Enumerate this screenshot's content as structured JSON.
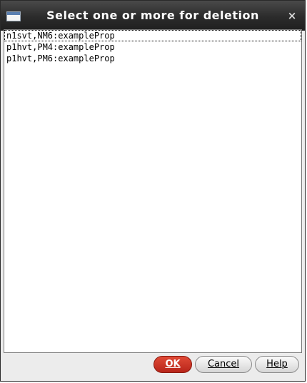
{
  "window": {
    "title": "Select one or more for deletion",
    "close_glyph": "×"
  },
  "list": {
    "items": [
      {
        "label": "n1svt,NM6:exampleProp",
        "focused": true
      },
      {
        "label": "p1hvt,PM4:exampleProp",
        "focused": false
      },
      {
        "label": "p1hvt,PM6:exampleProp",
        "focused": false
      }
    ]
  },
  "buttons": {
    "ok_label": "OK",
    "cancel_label": "Cancel",
    "help_label": "Help"
  },
  "colors": {
    "titlebar": "#2b2b2b",
    "ok_button": "#c7301f",
    "background": "#ececec"
  },
  "icons": {
    "window_icon": "window-icon",
    "close_icon": "close-icon"
  }
}
